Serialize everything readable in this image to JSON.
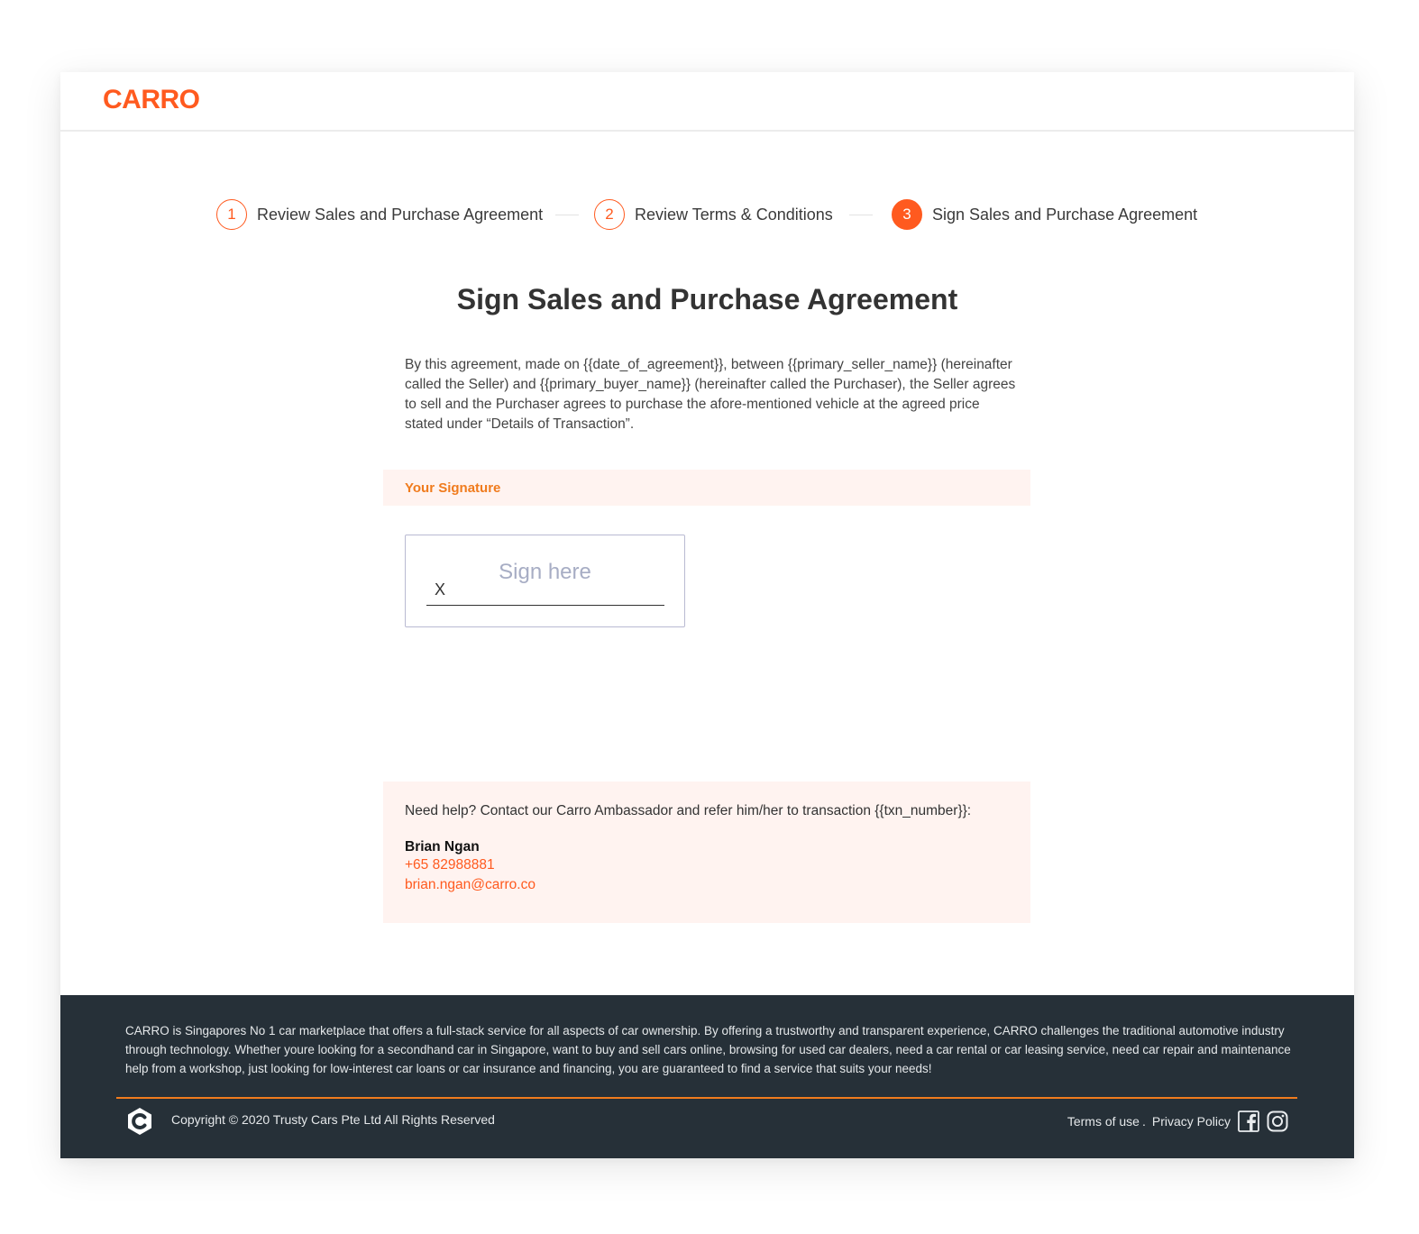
{
  "brand": {
    "logo_text": "CARRO",
    "accent": "#ff5a1f",
    "label_orange": "#f07b1d"
  },
  "stepper": {
    "steps": [
      {
        "number": "1",
        "label": "Review Sales and Purchase Agreement",
        "state": "completed"
      },
      {
        "number": "2",
        "label": "Review Terms & Conditions",
        "state": "completed"
      },
      {
        "number": "3",
        "label": "Sign Sales and Purchase Agreement",
        "state": "active"
      }
    ]
  },
  "main": {
    "title": "Sign Sales and Purchase Agreement",
    "intro": "By this agreement, made on {{date_of_agreement}}, between {{primary_seller_name}} (hereinafter called the Seller) and {{primary_buyer_name}} (hereinafter called the Purchaser), the Seller agrees to sell and the Purchaser agrees to purchase the afore-mentioned vehicle at the agreed price stated under “Details of Transaction”."
  },
  "signature": {
    "section_label": "Your Signature",
    "placeholder": "Sign here",
    "x_mark": "X"
  },
  "help": {
    "text": "Need help? Contact our Carro Ambassador and refer him/her to transaction {{txn_number}}:",
    "name": "Brian Ngan",
    "phone": "+65 82988881",
    "email": "brian.ngan@carro.co"
  },
  "footer": {
    "description": "CARRO is Singapores No 1 car marketplace that offers a full-stack service for all aspects of car ownership. By offering a trustworthy and transparent experience, CARRO challenges the traditional automotive industry through technology. Whether youre looking for a secondhand car in Singapore, want to buy and sell cars online, browsing for used car dealers, need a car rental or car leasing service, need car repair and maintenance help from a workshop, just looking for low-interest car loans or car insurance and financing, you are guaranteed to find a service that suits your needs!",
    "copyright": "Copyright © 2020 Trusty Cars Pte Ltd All Rights Reserved",
    "terms": "Terms of use",
    "separator": ".",
    "privacy": "Privacy Policy",
    "icons": [
      "carro-logo-icon",
      "facebook-icon",
      "instagram-icon"
    ]
  }
}
